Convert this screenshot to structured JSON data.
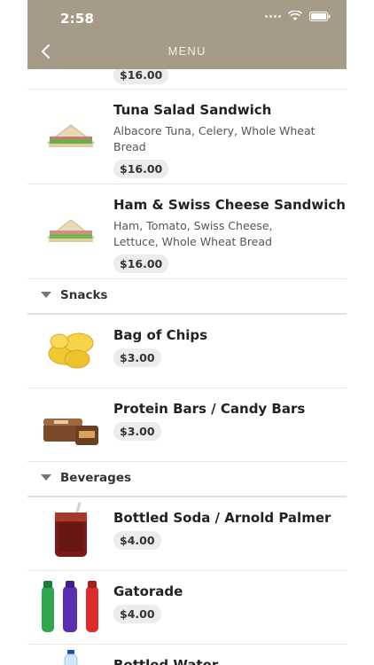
{
  "status": {
    "time": "2:58"
  },
  "nav": {
    "title": "MENU"
  },
  "top_sliver": {
    "price": "$16.00"
  },
  "items": [
    {
      "name": "Tuna Salad Sandwich",
      "desc": "Albacore Tuna, Celery, Whole Wheat Bread",
      "price": "$16.00"
    },
    {
      "name": "Ham & Swiss Cheese Sandwich",
      "desc": "Ham, Tomato, Swiss Cheese, Lettuce, Whole Wheat Bread",
      "price": "$16.00"
    }
  ],
  "sections": [
    {
      "title": "Snacks",
      "items": [
        {
          "name": "Bag of Chips",
          "price": "$3.00"
        },
        {
          "name": "Protein Bars / Candy Bars",
          "price": "$3.00"
        }
      ]
    },
    {
      "title": "Beverages",
      "items": [
        {
          "name": "Bottled Soda / Arnold Palmer",
          "price": "$4.00"
        },
        {
          "name": "Gatorade",
          "price": "$4.00"
        },
        {
          "name": "Bottled Water",
          "price": ""
        }
      ]
    }
  ],
  "icons": {
    "back": "chevron-left-icon",
    "wifi": "wifi-icon",
    "battery": "battery-icon",
    "section_toggle": "triangle-down-icon"
  }
}
